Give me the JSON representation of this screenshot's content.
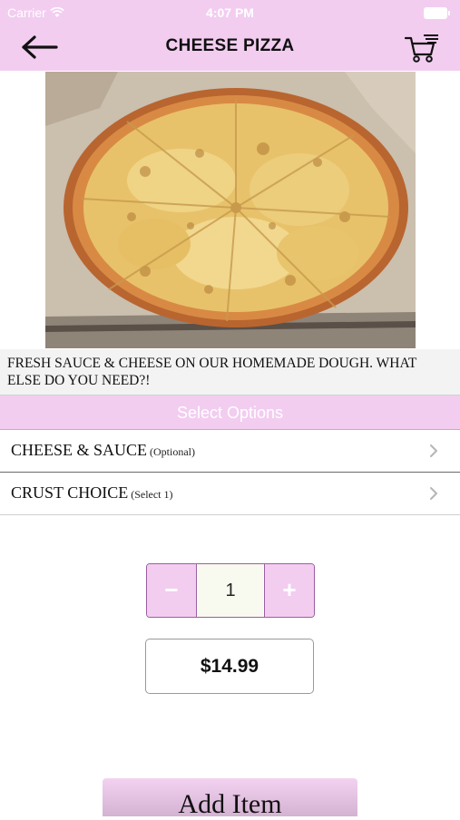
{
  "status_bar": {
    "carrier": "Carrier",
    "time": "4:07 PM"
  },
  "header": {
    "title": "CHEESE PIZZA",
    "back_icon": "arrow-left-icon",
    "cart_icon": "shopping-cart-icon"
  },
  "product": {
    "image_alt": "cheese-pizza-photo",
    "description": "FRESH SAUCE & CHEESE ON OUR HOMEMADE DOUGH. WHAT ELSE DO YOU NEED?!"
  },
  "options": {
    "header": "Select Options",
    "items": [
      {
        "name": "CHEESE & SAUCE",
        "note": "(Optional)"
      },
      {
        "name": "CRUST CHOICE",
        "note": "(Select 1)"
      }
    ]
  },
  "quantity": {
    "minus": "−",
    "value": "1",
    "plus": "+"
  },
  "price": "$14.99",
  "add_button": "Add Item",
  "colors": {
    "accent": "#f2cdf0",
    "accent_border": "#9a5fa0"
  }
}
